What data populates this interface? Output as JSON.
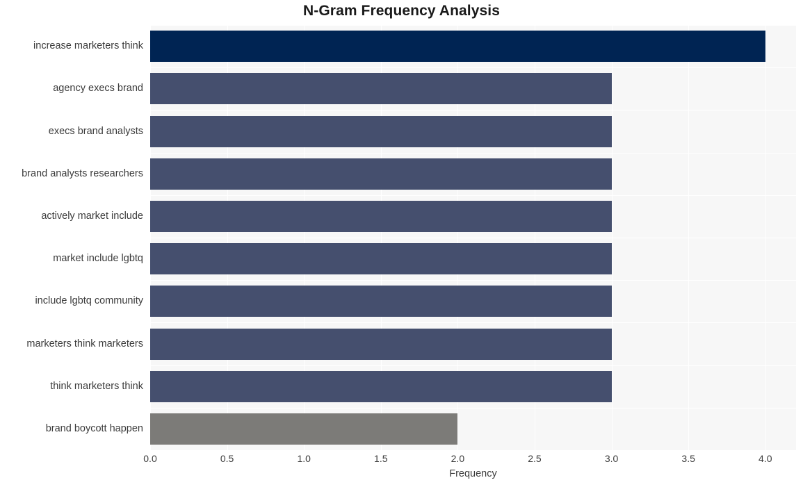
{
  "chart_data": {
    "type": "bar",
    "orientation": "horizontal",
    "title": "N-Gram Frequency Analysis",
    "xlabel": "Frequency",
    "ylabel": "",
    "xlim": [
      0,
      4.2
    ],
    "xticks": [
      "0.0",
      "0.5",
      "1.0",
      "1.5",
      "2.0",
      "2.5",
      "3.0",
      "3.5",
      "4.0"
    ],
    "xtick_values": [
      0,
      0.5,
      1,
      1.5,
      2,
      2.5,
      3,
      3.5,
      4
    ],
    "grid": true,
    "legend": "none",
    "categories": [
      "increase marketers think",
      "agency execs brand",
      "execs brand analysts",
      "brand analysts researchers",
      "actively market include",
      "market include lgbtq",
      "include lgbtq community",
      "marketers think marketers",
      "think marketers think",
      "brand boycott happen"
    ],
    "values": [
      4,
      3,
      3,
      3,
      3,
      3,
      3,
      3,
      3,
      2
    ],
    "bar_colors": [
      "#002453",
      "#454f6e",
      "#454f6e",
      "#454f6e",
      "#454f6e",
      "#454f6e",
      "#454f6e",
      "#454f6e",
      "#454f6e",
      "#7c7b78"
    ]
  },
  "style": {
    "plot_background": "#f7f7f7",
    "page_background": "#ffffff",
    "grid_color": "#ffffff",
    "text_color": "#3b3b3b",
    "title_color": "#1a1a1a"
  }
}
